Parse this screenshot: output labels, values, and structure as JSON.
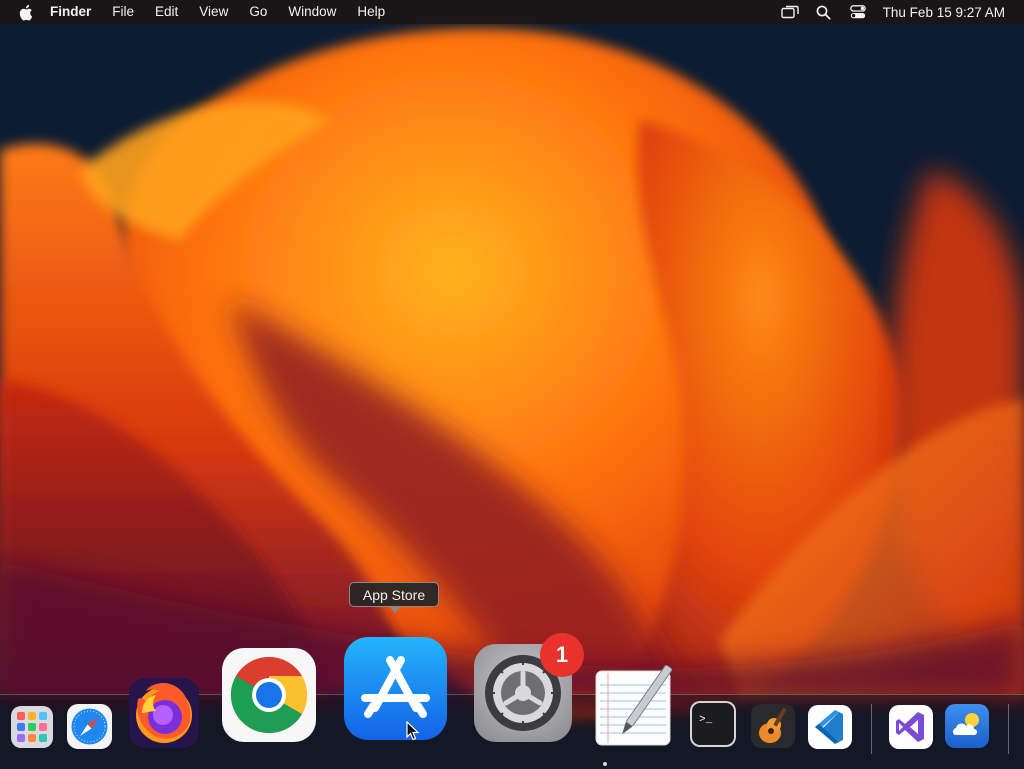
{
  "menubar": {
    "apple_icon": "apple-logo-icon",
    "items": [
      "Finder",
      "File",
      "Edit",
      "View",
      "Go",
      "Window",
      "Help"
    ],
    "status_icons": [
      "screen-mirroring-icon",
      "spotlight-search-icon",
      "control-center-icon"
    ],
    "clock": "Thu Feb 15  9:27 AM"
  },
  "tooltip": {
    "label": "App Store"
  },
  "dock": {
    "apps": [
      {
        "name": "Launchpad",
        "icon": "launchpad-icon"
      },
      {
        "name": "Safari",
        "icon": "safari-icon"
      },
      {
        "name": "Firefox",
        "icon": "firefox-icon"
      },
      {
        "name": "Google Chrome",
        "icon": "chrome-icon"
      },
      {
        "name": "App Store",
        "icon": "app-store-icon"
      },
      {
        "name": "System Settings",
        "icon": "system-settings-icon",
        "badge": "1"
      },
      {
        "name": "TextEdit",
        "icon": "textedit-icon"
      },
      {
        "name": "Terminal",
        "icon": "terminal-icon"
      },
      {
        "name": "GarageBand",
        "icon": "garageband-icon"
      },
      {
        "name": "Visual Studio Code",
        "icon": "vscode-icon"
      },
      {
        "name": "Visual Studio",
        "icon": "visual-studio-icon"
      },
      {
        "name": "Weather",
        "icon": "weather-icon"
      }
    ]
  },
  "colors": {
    "badge": "#e8322b",
    "app_store_blue": "#1e8cf5",
    "menubar_bg": "#1c1616"
  }
}
